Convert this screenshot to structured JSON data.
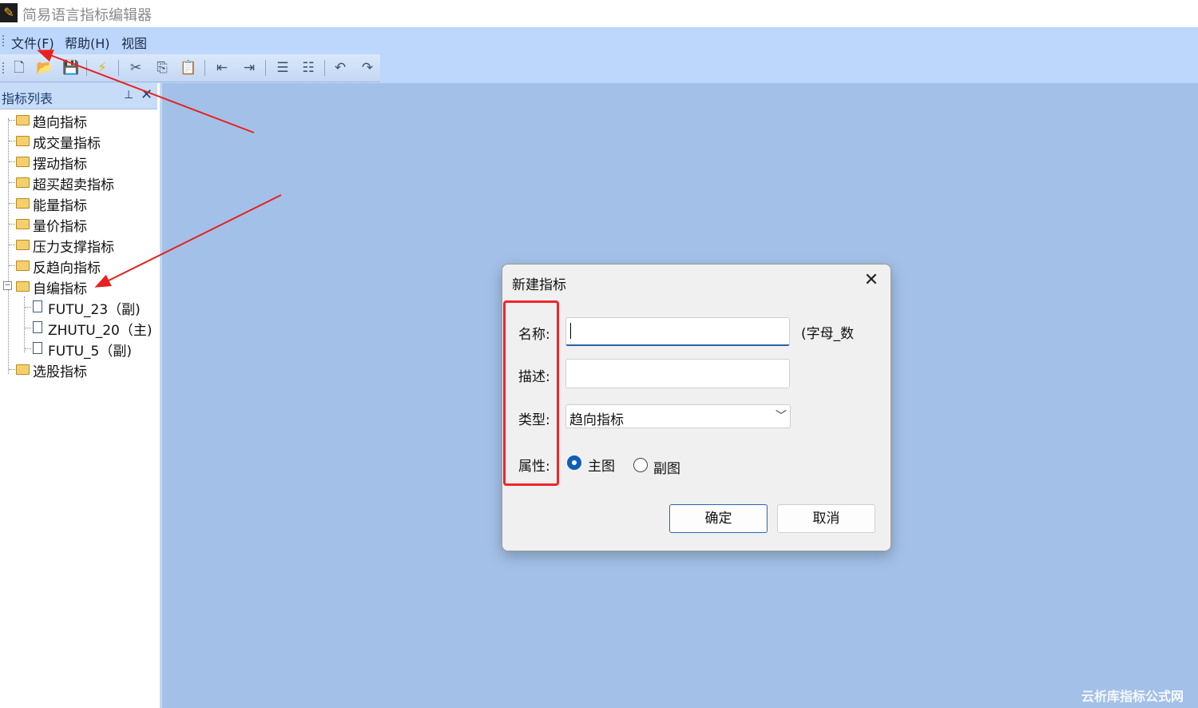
{
  "window": {
    "title": "简易语言指标编辑器",
    "icon": "pencil-icon"
  },
  "menu": [
    "文件(F)",
    "帮助(H)",
    "视图"
  ],
  "toolbar": [
    {
      "name": "new-file-icon",
      "glyph": "🗋"
    },
    {
      "name": "open-folder-icon",
      "glyph": "📂"
    },
    {
      "name": "save-icon",
      "glyph": "💾"
    },
    {
      "name": "compile-icon",
      "glyph": "⚡"
    },
    {
      "name": "cut-icon",
      "glyph": "✂"
    },
    {
      "name": "copy-icon",
      "glyph": "⎘"
    },
    {
      "name": "paste-icon",
      "glyph": "📋"
    },
    {
      "name": "outdent-icon",
      "glyph": "⇤"
    },
    {
      "name": "indent-icon",
      "glyph": "⇥"
    },
    {
      "name": "comment-icon",
      "glyph": "☰"
    },
    {
      "name": "uncomment-icon",
      "glyph": "☷"
    },
    {
      "name": "undo-icon",
      "glyph": "↶"
    },
    {
      "name": "redo-icon",
      "glyph": "↷"
    }
  ],
  "panel": {
    "title": "指标列表",
    "pin_glyph": "⊥",
    "close_glyph": "✕",
    "tree": [
      {
        "label": "趋向指标",
        "type": "folder"
      },
      {
        "label": "成交量指标",
        "type": "folder"
      },
      {
        "label": "摆动指标",
        "type": "folder"
      },
      {
        "label": "超买超卖指标",
        "type": "folder"
      },
      {
        "label": "能量指标",
        "type": "folder"
      },
      {
        "label": "量价指标",
        "type": "folder"
      },
      {
        "label": "压力支撑指标",
        "type": "folder"
      },
      {
        "label": "反趋向指标",
        "type": "folder"
      },
      {
        "label": "自编指标",
        "type": "folder",
        "expanded": true,
        "children": [
          {
            "label": "FUTU_23（副)",
            "type": "doc"
          },
          {
            "label": "ZHUTU_20（主)",
            "type": "doc"
          },
          {
            "label": "FUTU_5（副)",
            "type": "doc"
          }
        ]
      },
      {
        "label": "选股指标",
        "type": "folder"
      }
    ]
  },
  "dialog": {
    "title": "新建指标",
    "close_glyph": "✕",
    "fields": {
      "name_label": "名称:",
      "name_value": "",
      "name_hint": "(字母_数",
      "desc_label": "描述:",
      "desc_value": "",
      "type_label": "类型:",
      "type_value": "趋向指标",
      "attr_label": "属性:",
      "radio_main": "主图",
      "radio_sub": "副图",
      "selected": "主图"
    },
    "ok_label": "确定",
    "cancel_label": "取消"
  },
  "watermark": "云析库指标公式网",
  "colors": {
    "accent": "#0f5fb8",
    "highlight": "#f0252a",
    "workspace": "#a3c1e8",
    "menubar": "#bcd7fb"
  }
}
